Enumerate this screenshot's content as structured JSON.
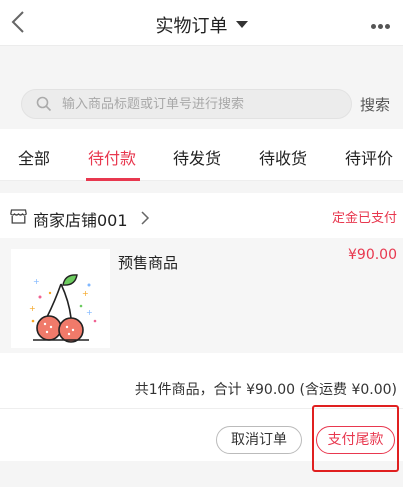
{
  "header": {
    "title": "实物订单",
    "back_icon": "chevron-left-icon",
    "more_icon": "more-icon"
  },
  "search": {
    "placeholder": "输入商品标题或订单号进行搜索",
    "button_label": "搜索",
    "icon": "search-icon"
  },
  "tabs": [
    {
      "label": "全部",
      "active": false
    },
    {
      "label": "待付款",
      "active": true
    },
    {
      "label": "待发货",
      "active": false
    },
    {
      "label": "待收货",
      "active": false
    },
    {
      "label": "待评价",
      "active": false
    }
  ],
  "order": {
    "shop_name": "商家店铺001",
    "status": "定金已支付",
    "item": {
      "name": "预售商品",
      "price": "¥90.00",
      "image": "cherry-image"
    },
    "summary": "共1件商品，合计 ¥90.00 (含运费 ¥0.00)",
    "actions": {
      "cancel_label": "取消订单",
      "pay_label": "支付尾款"
    }
  },
  "colors": {
    "accent": "#e8384f",
    "highlight": "#e02020"
  }
}
